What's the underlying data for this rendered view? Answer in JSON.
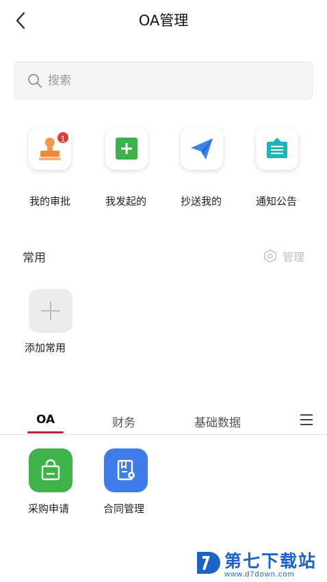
{
  "header": {
    "title": "OA管理"
  },
  "search": {
    "placeholder": "搜索"
  },
  "quick_actions": [
    {
      "label": "我的审批",
      "icon": "approval-stamp-icon",
      "badge": "1"
    },
    {
      "label": "我发起的",
      "icon": "plus-square-icon"
    },
    {
      "label": "抄送我的",
      "icon": "paper-plane-icon"
    },
    {
      "label": "通知公告",
      "icon": "announcement-icon"
    }
  ],
  "common": {
    "title": "常用",
    "manage_label": "管理",
    "add_label": "添加常用"
  },
  "tabs": [
    {
      "label": "OA",
      "active": true
    },
    {
      "label": "财务",
      "active": false
    },
    {
      "label": "基础数据",
      "active": false
    }
  ],
  "apps": [
    {
      "label": "采购申请",
      "icon": "shopping-bag-icon",
      "color": "#3db34a"
    },
    {
      "label": "合同管理",
      "icon": "contract-icon",
      "color": "#3e7ce8"
    }
  ],
  "watermark": {
    "name": "第七下载站",
    "url": "www.d7down.com"
  },
  "colors": {
    "accent": "#b8243a",
    "badge": "#e23a3a"
  }
}
